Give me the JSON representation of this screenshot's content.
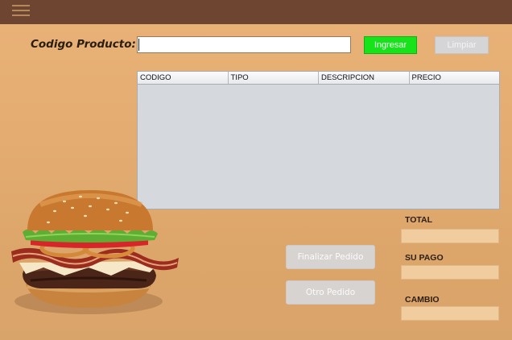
{
  "header": {
    "menu_icon": "hamburger-menu-icon"
  },
  "form": {
    "code_label": "Codigo Producto:",
    "code_value": "",
    "ingresar_label": "Ingresar",
    "limpiar_label": "Limpiar"
  },
  "table": {
    "columns": [
      "CODIGO",
      "TIPO",
      "DESCRIPCION",
      "PRECIO"
    ],
    "rows": []
  },
  "totals": {
    "total_label": "TOTAL",
    "total_value": "",
    "supago_label": "SU PAGO",
    "supago_value": "",
    "cambio_label": "CAMBIO",
    "cambio_value": ""
  },
  "actions": {
    "finalizar_label": "Finalizar Pedido",
    "otro_label": "Otro Pedido"
  },
  "colors": {
    "topbar": "#6d4530",
    "ingresar": "#17e31a",
    "background": "#e4ac70"
  },
  "image": {
    "icon": "burger-image"
  }
}
